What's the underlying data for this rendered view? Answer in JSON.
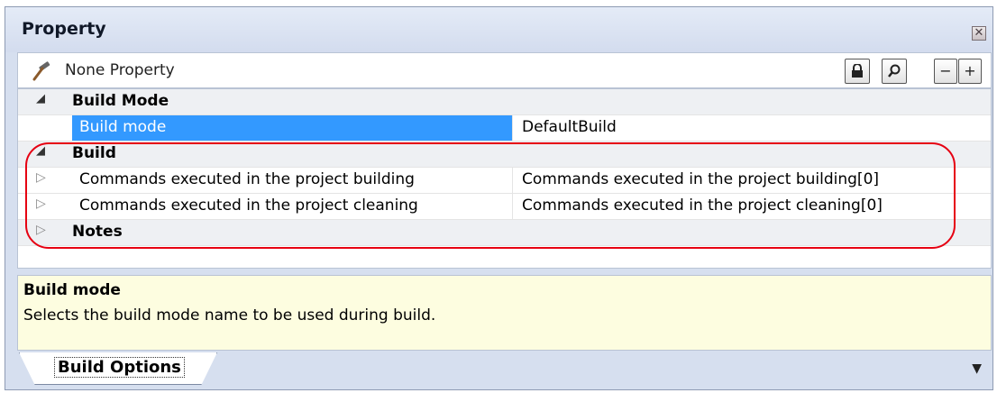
{
  "panel": {
    "title": "Property",
    "close_glyph": "✕"
  },
  "toolbar": {
    "icon": "hammer-icon",
    "label": "None Property",
    "buttons": [
      {
        "name": "lock",
        "glyph": "🔒"
      },
      {
        "name": "search",
        "glyph": "⚲"
      },
      {
        "name": "collapse",
        "glyph": "−"
      },
      {
        "name": "expand",
        "glyph": "+"
      }
    ]
  },
  "grid": {
    "categories": [
      {
        "label": "Build Mode",
        "expanded": true,
        "rows": [
          {
            "name": "Build mode",
            "value": "DefaultBuild",
            "selected": true
          }
        ]
      },
      {
        "label": "Build",
        "expanded": true,
        "rows": [
          {
            "name": "Commands executed in the project building",
            "value": "Commands executed in the project building[0]"
          },
          {
            "name": "Commands executed in the project cleaning",
            "value": "Commands executed in the project cleaning[0]"
          }
        ]
      },
      {
        "label": "Notes",
        "expanded": false,
        "rows": []
      }
    ]
  },
  "description": {
    "title": "Build mode",
    "text": "Selects the build mode name to be used during build."
  },
  "tabs": [
    {
      "label": "Build Options",
      "active": true
    }
  ],
  "colors": {
    "selection": "#3399ff",
    "annotation": "#e60012",
    "description_bg": "#fdfde0",
    "panel_bg": "#d6dfef"
  }
}
